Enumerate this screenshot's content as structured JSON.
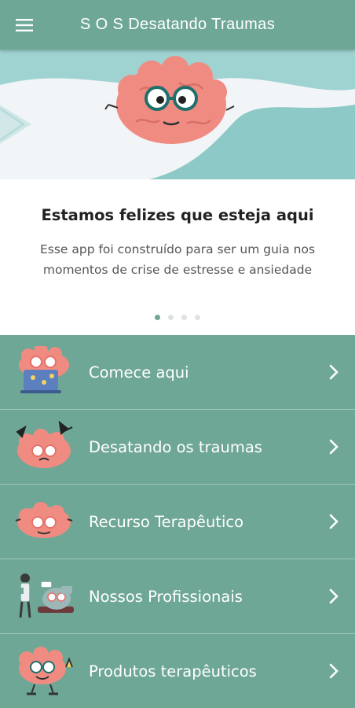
{
  "app": {
    "title": "S O S Desatando Traumas"
  },
  "colors": {
    "primary": "#6fa796",
    "card_bg": "#ffffff",
    "brain_pink": "#f08b82"
  },
  "welcome": {
    "title": "Estamos felizes que esteja aqui",
    "text": "Esse app foi construído para ser um guia nos momentos de crise de estresse e ansiedade",
    "pages": 4,
    "active_page": 1
  },
  "menu": [
    {
      "label": "Comece aqui",
      "icon": "brain-laptop-icon"
    },
    {
      "label": "Desatando os traumas",
      "icon": "brain-knots-icon"
    },
    {
      "label": "Recurso Terapêutico",
      "icon": "brain-glasses-icon"
    },
    {
      "label": "Nossos Profissionais",
      "icon": "therapist-session-icon"
    },
    {
      "label": "Produtos terapêuticos",
      "icon": "brain-thumbs-up-icon"
    }
  ]
}
